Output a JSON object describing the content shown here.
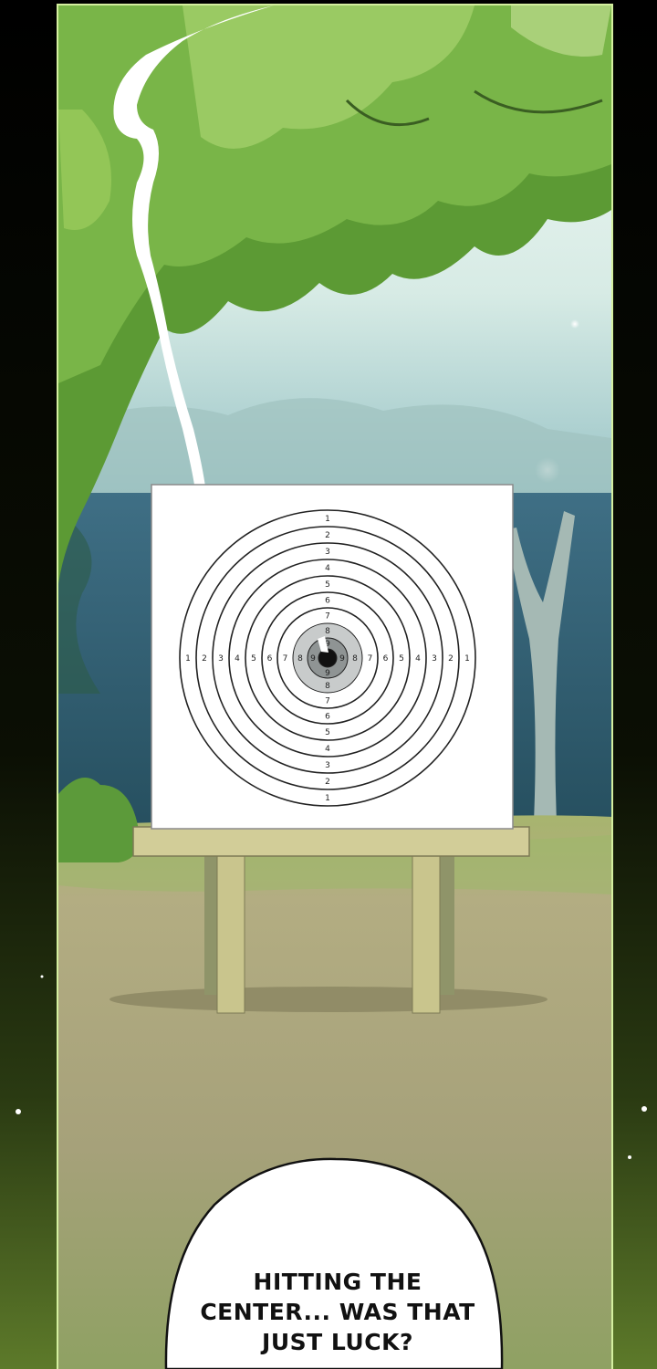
{
  "panel": {
    "scene": "archery-target-in-forest-clearing",
    "speech_bubble": {
      "lines": [
        "HITTING THE",
        "CENTER... WAS THAT",
        "JUST LUCK?"
      ]
    },
    "target": {
      "numbers_vertical": [
        "1",
        "2",
        "3",
        "4",
        "5",
        "6",
        "7",
        "8",
        "9",
        "9",
        "8",
        "7",
        "6",
        "5",
        "4",
        "3",
        "2",
        "1"
      ],
      "numbers_horizontal": [
        "1",
        "2",
        "3",
        "4",
        "5",
        "6",
        "7",
        "8",
        "9",
        "9",
        "8",
        "7",
        "6",
        "5",
        "4",
        "3",
        "2",
        "1"
      ]
    },
    "colors": {
      "frame_border": "#d7f0a8",
      "sky_glow": "#e8f3ee",
      "leaves": "#6faa3a",
      "ground": "#a9a57a",
      "grass": "#8cae5e",
      "stand_wood": "#cbc68c",
      "bubble_fill": "#ffffff"
    }
  }
}
